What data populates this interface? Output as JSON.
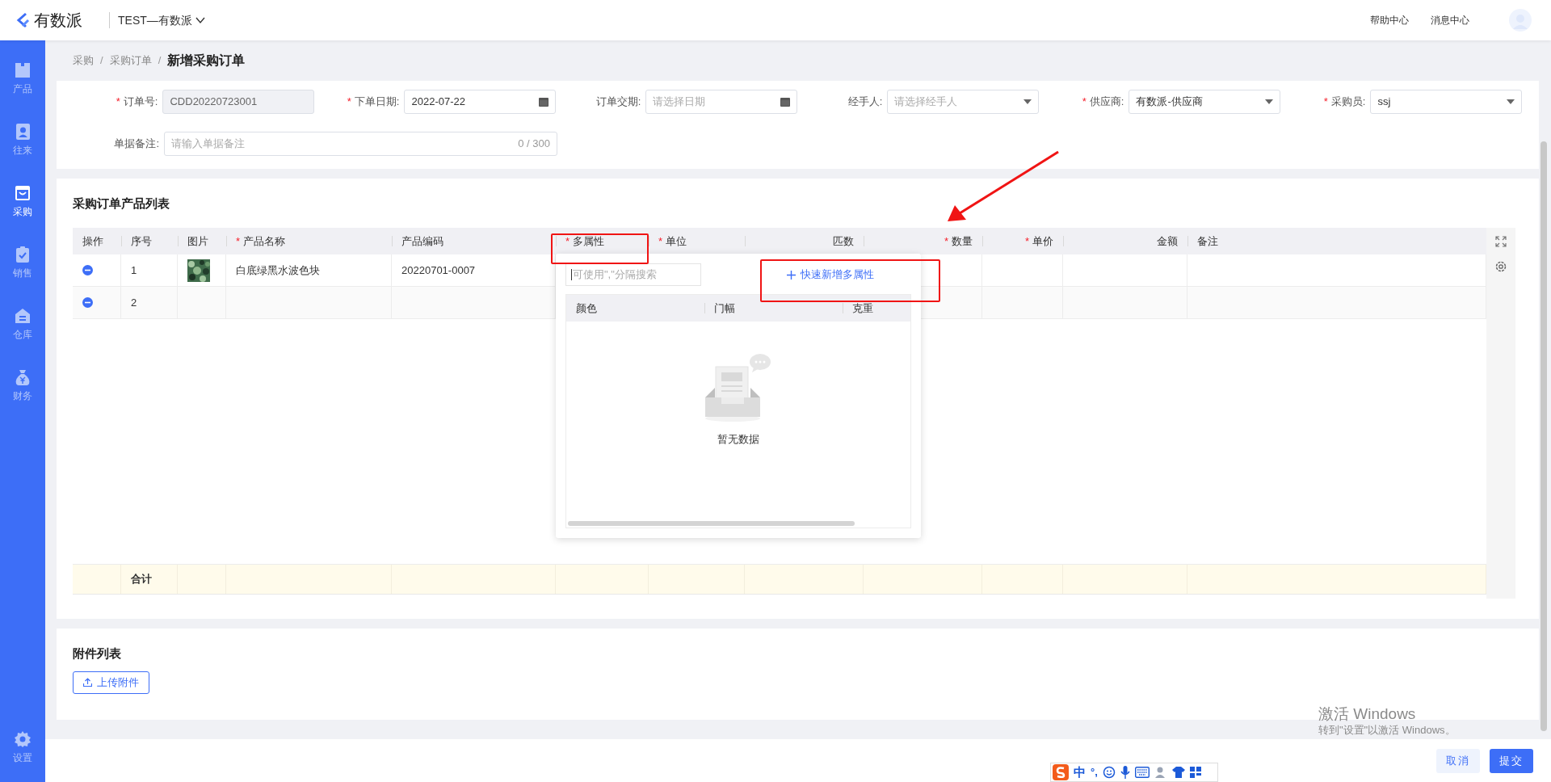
{
  "header": {
    "logo": "有数派",
    "tenant": "TEST—有数派",
    "links": [
      "帮助中心",
      "消息中心"
    ]
  },
  "sidebar": {
    "items": [
      {
        "label": "产品",
        "selected": false
      },
      {
        "label": "往来",
        "selected": false
      },
      {
        "label": "采购",
        "selected": true
      },
      {
        "label": "销售",
        "selected": false
      },
      {
        "label": "仓库",
        "selected": false
      },
      {
        "label": "财务",
        "selected": false
      }
    ],
    "bottom_item": {
      "label": "设置",
      "selected": false
    }
  },
  "breadcrumb": {
    "separator": "/",
    "items": [
      "采购",
      "采购订单",
      "新增采购订单"
    ]
  },
  "required_mark": "*",
  "form": {
    "fields": [
      {
        "label": "订单号:",
        "required": true,
        "kind": "text",
        "value": "CDD20220723001",
        "disabled": true
      },
      {
        "label": "下单日期:",
        "required": true,
        "kind": "date",
        "value": "2022-07-22",
        "disabled": false
      },
      {
        "label": "订单交期:",
        "required": false,
        "kind": "date",
        "placeholder": "请选择日期",
        "disabled": false
      },
      {
        "label": "经手人:",
        "required": false,
        "kind": "select",
        "placeholder": "请选择经手人",
        "disabled": false
      },
      {
        "label": "供应商:",
        "required": true,
        "kind": "select",
        "value": "有数派-供应商",
        "disabled": false
      },
      {
        "label": "采购员:",
        "required": true,
        "kind": "select",
        "value": "ssj",
        "disabled": false
      }
    ],
    "remark": {
      "label": "单据备注:",
      "placeholder": "请输入单据备注",
      "counter": "0 / 300"
    }
  },
  "product_list": {
    "title": "采购订单产品列表",
    "columns": [
      {
        "label": "操作",
        "required": false,
        "highlighted": false
      },
      {
        "label": "序号",
        "required": false,
        "highlighted": false
      },
      {
        "label": "图片",
        "required": false,
        "highlighted": false
      },
      {
        "label": "产品名称",
        "required": true,
        "highlighted": false
      },
      {
        "label": "产品编码",
        "required": false,
        "highlighted": false
      },
      {
        "label": "多属性",
        "required": true,
        "highlighted": true
      },
      {
        "label": "单位",
        "required": true,
        "highlighted": false
      },
      {
        "label": "匹数",
        "required": false,
        "highlighted": false
      },
      {
        "label": "数量",
        "required": true,
        "highlighted": false
      },
      {
        "label": "单价",
        "required": true,
        "highlighted": false
      },
      {
        "label": "金额",
        "required": false,
        "highlighted": false
      },
      {
        "label": "备注",
        "required": false,
        "highlighted": false
      }
    ],
    "rows": [
      {
        "index": "1",
        "name": "白底绿黑水波色块",
        "code": "20220701-0007"
      },
      {
        "index": "2"
      }
    ],
    "total_label": "合计"
  },
  "attribute_dropdown": {
    "search_placeholder": "可使用\",\"分隔搜索",
    "quick_add": {
      "label": "快速新增多属性",
      "highlighted": true
    },
    "columns": [
      "颜色",
      "门幅",
      "克重"
    ],
    "empty_text": "暂无数据"
  },
  "arrow_annotation": true,
  "attachments": {
    "title": "附件列表",
    "upload_button": "上传附件"
  },
  "footer": {
    "buttons": [
      {
        "label": "取消",
        "kind": "secondary"
      },
      {
        "label": "提交",
        "kind": "primary"
      }
    ]
  },
  "system": {
    "activation_title": "激活 Windows",
    "activation_text": "转到\"设置\"以激活 Windows。",
    "ime_label": "中",
    "ime_punct": "°,"
  }
}
